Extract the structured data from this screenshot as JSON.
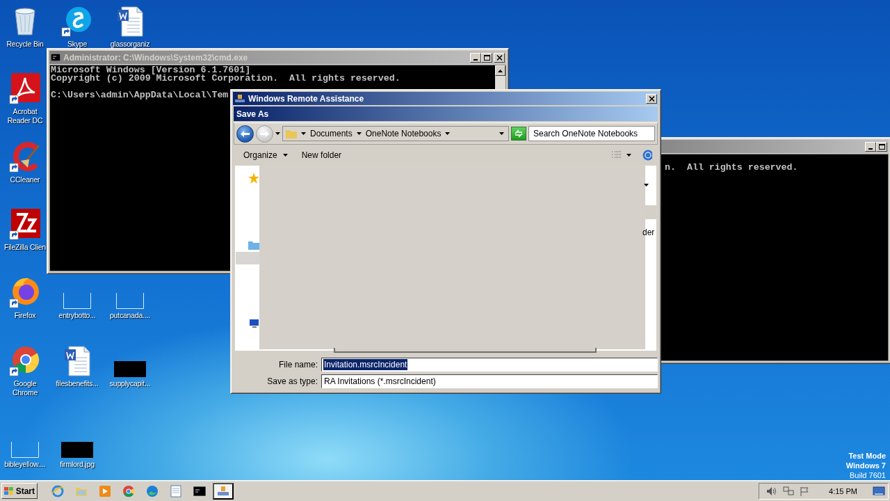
{
  "desktop_icons": [
    {
      "label": "Recycle Bin",
      "kind": "recycle",
      "shortcut": false
    },
    {
      "label": "Skype",
      "kind": "skype",
      "shortcut": true
    },
    {
      "label": "glassorganiz",
      "kind": "word",
      "shortcut": false
    },
    {
      "label": "Acrobat Reader DC",
      "kind": "acrobat",
      "shortcut": true
    },
    {
      "label": "CCleaner",
      "kind": "ccleaner",
      "shortcut": true
    },
    {
      "label": "FileZilla Clien",
      "kind": "filezilla",
      "shortcut": true
    },
    {
      "label": "Firefox",
      "kind": "firefox",
      "shortcut": true
    },
    {
      "label": "entrybotto...",
      "kind": "blank",
      "shortcut": false
    },
    {
      "label": "putcanada....",
      "kind": "blank",
      "shortcut": false
    },
    {
      "label": "Google Chrome",
      "kind": "chrome",
      "shortcut": true
    },
    {
      "label": "filesbenefits...",
      "kind": "word",
      "shortcut": false
    },
    {
      "label": "supplycapit...",
      "kind": "black",
      "shortcut": false
    },
    {
      "label": "bibleyellow....",
      "kind": "blank",
      "shortcut": false
    },
    {
      "label": "firmlord.jpg",
      "kind": "black",
      "shortcut": false
    }
  ],
  "cmd_windows": [
    {
      "title": "Administrator: C:\\Windows\\System32\\cmd.exe",
      "active": false,
      "lines": [
        "Microsoft Windows [Version 6.1.7601]",
        "Copyright (c) 2009 Microsoft Corporation.  All rights reserved."
      ],
      "prompt": "C:\\Users\\admin\\AppData\\Local\\Tem"
    },
    {
      "active": false,
      "lines": [
        "n.  All rights reserved."
      ]
    }
  ],
  "dialog": {
    "title": "Windows Remote Assistance",
    "active": true,
    "subtitle": "Save As",
    "breadcrumb": [
      "Documents",
      "OneNote Notebooks"
    ],
    "search": {
      "placeholder": "Search OneNote Notebooks"
    },
    "toolbar": [
      {
        "label": "Organize",
        "menu": true
      },
      {
        "label": "New folder",
        "menu": false
      }
    ],
    "partial_text": "der",
    "file_name": {
      "label": "File name:",
      "value": "Invitation.msrcIncident",
      "selected": true
    },
    "save_as_type": {
      "label": "Save as type:",
      "value": "RA Invitations (*.msrcIncident)"
    }
  },
  "system_info": [
    "Test Mode",
    "Windows 7",
    "Build 7601"
  ],
  "taskbar": {
    "start": "Start",
    "apps": [
      {
        "kind": "ie",
        "selected": false
      },
      {
        "kind": "explorer",
        "selected": false
      },
      {
        "kind": "media",
        "selected": false
      },
      {
        "kind": "chrome",
        "selected": false
      },
      {
        "kind": "edge",
        "selected": false
      },
      {
        "kind": "notepad",
        "selected": false
      },
      {
        "kind": "cmd",
        "selected": false
      },
      {
        "kind": "remote",
        "selected": true
      }
    ],
    "clock": "4:15 PM"
  }
}
